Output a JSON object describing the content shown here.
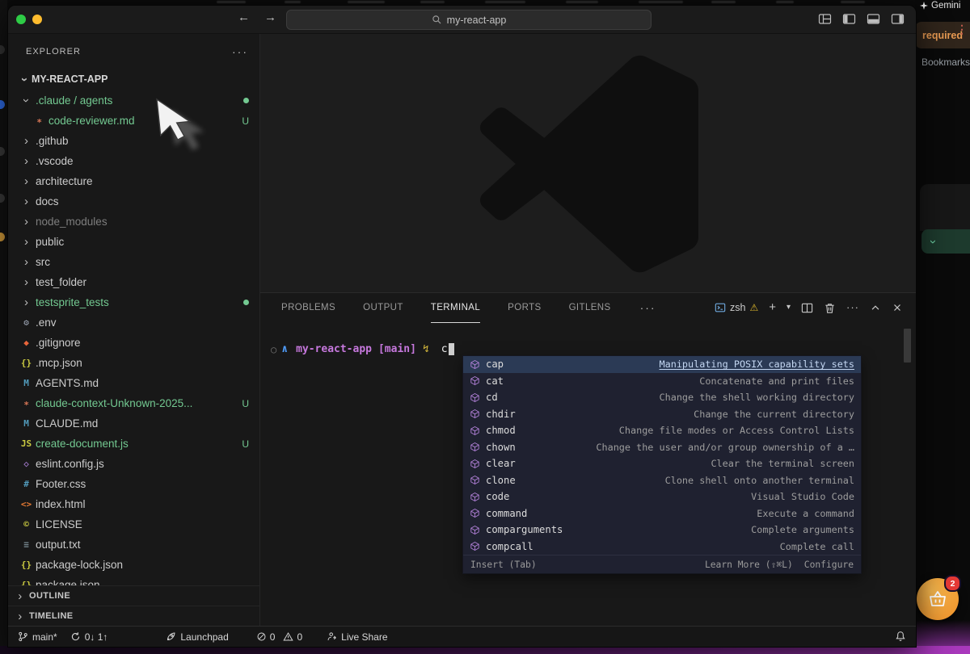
{
  "background": {
    "gemini_label": "Gemini",
    "toast_label": "required",
    "bookmarks_label": "Bookmarks",
    "cart_badge": "2"
  },
  "titlebar": {
    "search_value": "my-react-app"
  },
  "explorer": {
    "header": "EXPLORER",
    "root": "MY-REACT-APP",
    "items": [
      {
        "label": ".claude / agents",
        "kind": "folder",
        "expanded": true,
        "green": true,
        "dot": true,
        "indent": 0
      },
      {
        "label": "code-reviewer.md",
        "kind": "file",
        "icon": "claude-icon",
        "green": true,
        "badge": "U",
        "indent": 1
      },
      {
        "label": ".github",
        "kind": "folder",
        "indent": 0
      },
      {
        "label": ".vscode",
        "kind": "folder",
        "indent": 0
      },
      {
        "label": "architecture",
        "kind": "folder",
        "indent": 0
      },
      {
        "label": "docs",
        "kind": "folder",
        "indent": 0
      },
      {
        "label": "node_modules",
        "kind": "folder",
        "dim": true,
        "indent": 0
      },
      {
        "label": "public",
        "kind": "folder",
        "indent": 0
      },
      {
        "label": "src",
        "kind": "folder",
        "indent": 0
      },
      {
        "label": "test_folder",
        "kind": "folder",
        "indent": 0
      },
      {
        "label": "testsprite_tests",
        "kind": "folder",
        "green": true,
        "dot": true,
        "indent": 0
      },
      {
        "label": ".env",
        "kind": "file",
        "icon": "gear-icon",
        "indent": 0
      },
      {
        "label": ".gitignore",
        "kind": "file",
        "icon": "git-icon",
        "indent": 0
      },
      {
        "label": ".mcp.json",
        "kind": "file",
        "icon": "json-icon",
        "indent": 0
      },
      {
        "label": "AGENTS.md",
        "kind": "file",
        "icon": "markdown-icon",
        "indent": 0
      },
      {
        "label": "claude-context-Unknown-2025...",
        "kind": "file",
        "icon": "claude-icon",
        "green": true,
        "badge": "U",
        "indent": 0
      },
      {
        "label": "CLAUDE.md",
        "kind": "file",
        "icon": "markdown-icon",
        "indent": 0
      },
      {
        "label": "create-document.js",
        "kind": "file",
        "icon": "js-icon",
        "green": true,
        "badge": "U",
        "indent": 0
      },
      {
        "label": "eslint.config.js",
        "kind": "file",
        "icon": "eslint-icon",
        "indent": 0
      },
      {
        "label": "Footer.css",
        "kind": "file",
        "icon": "css-icon",
        "indent": 0
      },
      {
        "label": "index.html",
        "kind": "file",
        "icon": "html-icon",
        "indent": 0
      },
      {
        "label": "LICENSE",
        "kind": "file",
        "icon": "license-icon",
        "indent": 0
      },
      {
        "label": "output.txt",
        "kind": "file",
        "icon": "text-icon",
        "indent": 0
      },
      {
        "label": "package-lock.json",
        "kind": "file",
        "icon": "json-icon",
        "indent": 0
      },
      {
        "label": "package.json",
        "kind": "file",
        "icon": "json-icon",
        "indent": 0
      }
    ],
    "sections": [
      "OUTLINE",
      "TIMELINE"
    ]
  },
  "panel": {
    "tabs": [
      {
        "label": "PROBLEMS",
        "active": false
      },
      {
        "label": "OUTPUT",
        "active": false
      },
      {
        "label": "TERMINAL",
        "active": true
      },
      {
        "label": "PORTS",
        "active": false
      },
      {
        "label": "GITLENS",
        "active": false
      }
    ],
    "shell_label": "zsh"
  },
  "terminal": {
    "repo": "my-react-app",
    "branch": "[main]",
    "typed": "c"
  },
  "suggest": {
    "items": [
      {
        "name": "cap",
        "desc": "Manipulating POSIX capability sets",
        "selected": true
      },
      {
        "name": "cat",
        "desc": "Concatenate and print files"
      },
      {
        "name": "cd",
        "desc": "Change the shell working directory"
      },
      {
        "name": "chdir",
        "desc": "Change the current directory"
      },
      {
        "name": "chmod",
        "desc": "Change file modes or Access Control Lists"
      },
      {
        "name": "chown",
        "desc": "Change the user and/or group ownership of a …"
      },
      {
        "name": "clear",
        "desc": "Clear the terminal screen"
      },
      {
        "name": "clone",
        "desc": "Clone shell onto another terminal"
      },
      {
        "name": "code",
        "desc": "Visual Studio Code"
      },
      {
        "name": "command",
        "desc": "Execute a command"
      },
      {
        "name": "comparguments",
        "desc": "Complete arguments"
      },
      {
        "name": "compcall",
        "desc": "Complete call"
      }
    ],
    "footer_insert": "Insert (Tab)",
    "footer_learn": "Learn More (⇧⌘L)",
    "footer_configure": "Configure"
  },
  "statusbar": {
    "branch": "main*",
    "sync": "0↓ 1↑",
    "launchpad": "Launchpad",
    "errors": "0",
    "warnings": "0",
    "liveshare": "Live Share"
  },
  "colors": {
    "git_green": "#73c991",
    "accent_blue": "#3794ff",
    "warning_yellow": "#ddb62b",
    "prompt_magenta": "#c678dd",
    "claude_orange": "#d97757"
  }
}
